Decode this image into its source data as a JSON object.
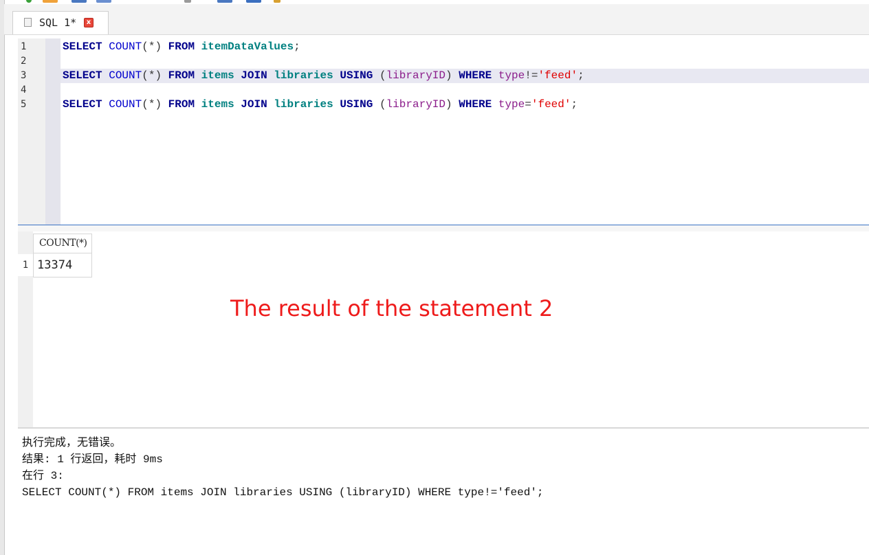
{
  "tab": {
    "label": "SQL 1*",
    "close_glyph": "x"
  },
  "editor": {
    "line_numbers": [
      "1",
      "2",
      "3",
      "4",
      "5"
    ],
    "lines": [
      {
        "tokens": [
          {
            "t": "SELECT",
            "c": "kw"
          },
          {
            "t": " "
          },
          {
            "t": "COUNT",
            "c": "fn"
          },
          {
            "t": "(*)",
            "c": "op"
          },
          {
            "t": " "
          },
          {
            "t": "FROM",
            "c": "kw"
          },
          {
            "t": " "
          },
          {
            "t": "itemDataValues",
            "c": "tbl"
          },
          {
            "t": ";",
            "c": "op"
          }
        ]
      },
      {
        "tokens": []
      },
      {
        "current": true,
        "tokens": [
          {
            "t": "SELECT",
            "c": "kw"
          },
          {
            "t": " "
          },
          {
            "t": "COUNT",
            "c": "fn"
          },
          {
            "t": "(*)",
            "c": "op"
          },
          {
            "t": " "
          },
          {
            "t": "FROM",
            "c": "kw"
          },
          {
            "t": " "
          },
          {
            "t": "items",
            "c": "tbl"
          },
          {
            "t": " "
          },
          {
            "t": "JOIN",
            "c": "kw"
          },
          {
            "t": " "
          },
          {
            "t": "libraries",
            "c": "tbl"
          },
          {
            "t": " "
          },
          {
            "t": "USING",
            "c": "kw"
          },
          {
            "t": " "
          },
          {
            "t": "(",
            "c": "op"
          },
          {
            "t": "libraryID",
            "c": "col"
          },
          {
            "t": ")",
            "c": "op"
          },
          {
            "t": " "
          },
          {
            "t": "WHERE",
            "c": "kw"
          },
          {
            "t": " "
          },
          {
            "t": "type",
            "c": "col"
          },
          {
            "t": "!=",
            "c": "op"
          },
          {
            "t": "'feed'",
            "c": "str"
          },
          {
            "t": ";",
            "c": "op"
          }
        ]
      },
      {
        "tokens": []
      },
      {
        "tokens": [
          {
            "t": "SELECT",
            "c": "kw"
          },
          {
            "t": " "
          },
          {
            "t": "COUNT",
            "c": "fn"
          },
          {
            "t": "(*)",
            "c": "op"
          },
          {
            "t": " "
          },
          {
            "t": "FROM",
            "c": "kw"
          },
          {
            "t": " "
          },
          {
            "t": "items",
            "c": "tbl"
          },
          {
            "t": " "
          },
          {
            "t": "JOIN",
            "c": "kw"
          },
          {
            "t": " "
          },
          {
            "t": "libraries",
            "c": "tbl"
          },
          {
            "t": " "
          },
          {
            "t": "USING",
            "c": "kw"
          },
          {
            "t": " "
          },
          {
            "t": "(",
            "c": "op"
          },
          {
            "t": "libraryID",
            "c": "col"
          },
          {
            "t": ")",
            "c": "op"
          },
          {
            "t": " "
          },
          {
            "t": "WHERE",
            "c": "kw"
          },
          {
            "t": " "
          },
          {
            "t": "type",
            "c": "col"
          },
          {
            "t": "=",
            "c": "op"
          },
          {
            "t": "'feed'",
            "c": "str"
          },
          {
            "t": ";",
            "c": "op"
          }
        ]
      }
    ]
  },
  "results": {
    "column_header": "COUNT(*)",
    "row_number": "1",
    "cell_value": "13374",
    "annotation": "The result of the statement 2"
  },
  "messages": {
    "lines": [
      "执行完成，无错误。",
      "结果: 1 行返回，耗时 9ms",
      "在行 3:",
      "SELECT COUNT(*) FROM items JOIN libraries USING (libraryID) WHERE type!='feed';"
    ]
  },
  "colors": {
    "keyword": "#00008b",
    "function": "#0000cd",
    "table": "#008080",
    "column": "#8b1d8b",
    "string": "#e00000",
    "annotation": "#ee1b1b",
    "splitter": "#3a72c4"
  }
}
